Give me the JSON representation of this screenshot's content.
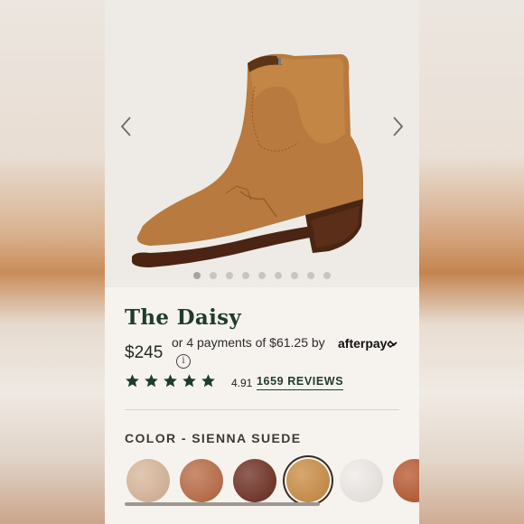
{
  "product": {
    "title": "The Daisy",
    "price": "$245",
    "payments_text": "or 4 payments of $61.25 by",
    "afterpay_label": "afterpay",
    "rating_value": "4.91",
    "stars_filled": 5,
    "reviews_label": "1659 REVIEWS"
  },
  "gallery": {
    "dot_count": 9,
    "active_dot": 0
  },
  "color": {
    "label": "COLOR - SIENNA SUEDE",
    "swatches": [
      {
        "name": "tan-leather",
        "color": "#d8b597",
        "selected": false
      },
      {
        "name": "copper-leather",
        "color": "#b8673f",
        "selected": false
      },
      {
        "name": "chocolate-leather",
        "color": "#6b2a1d",
        "selected": false
      },
      {
        "name": "sienna-suede",
        "color": "#c98a3f",
        "selected": true
      },
      {
        "name": "white-leather",
        "color": "#eeeae6",
        "selected": false
      },
      {
        "name": "rust-leather",
        "color": "#b5532a",
        "selected": false
      }
    ]
  },
  "colors": {
    "brand_green": "#1f3b2e",
    "background": "#f6f3ef"
  }
}
